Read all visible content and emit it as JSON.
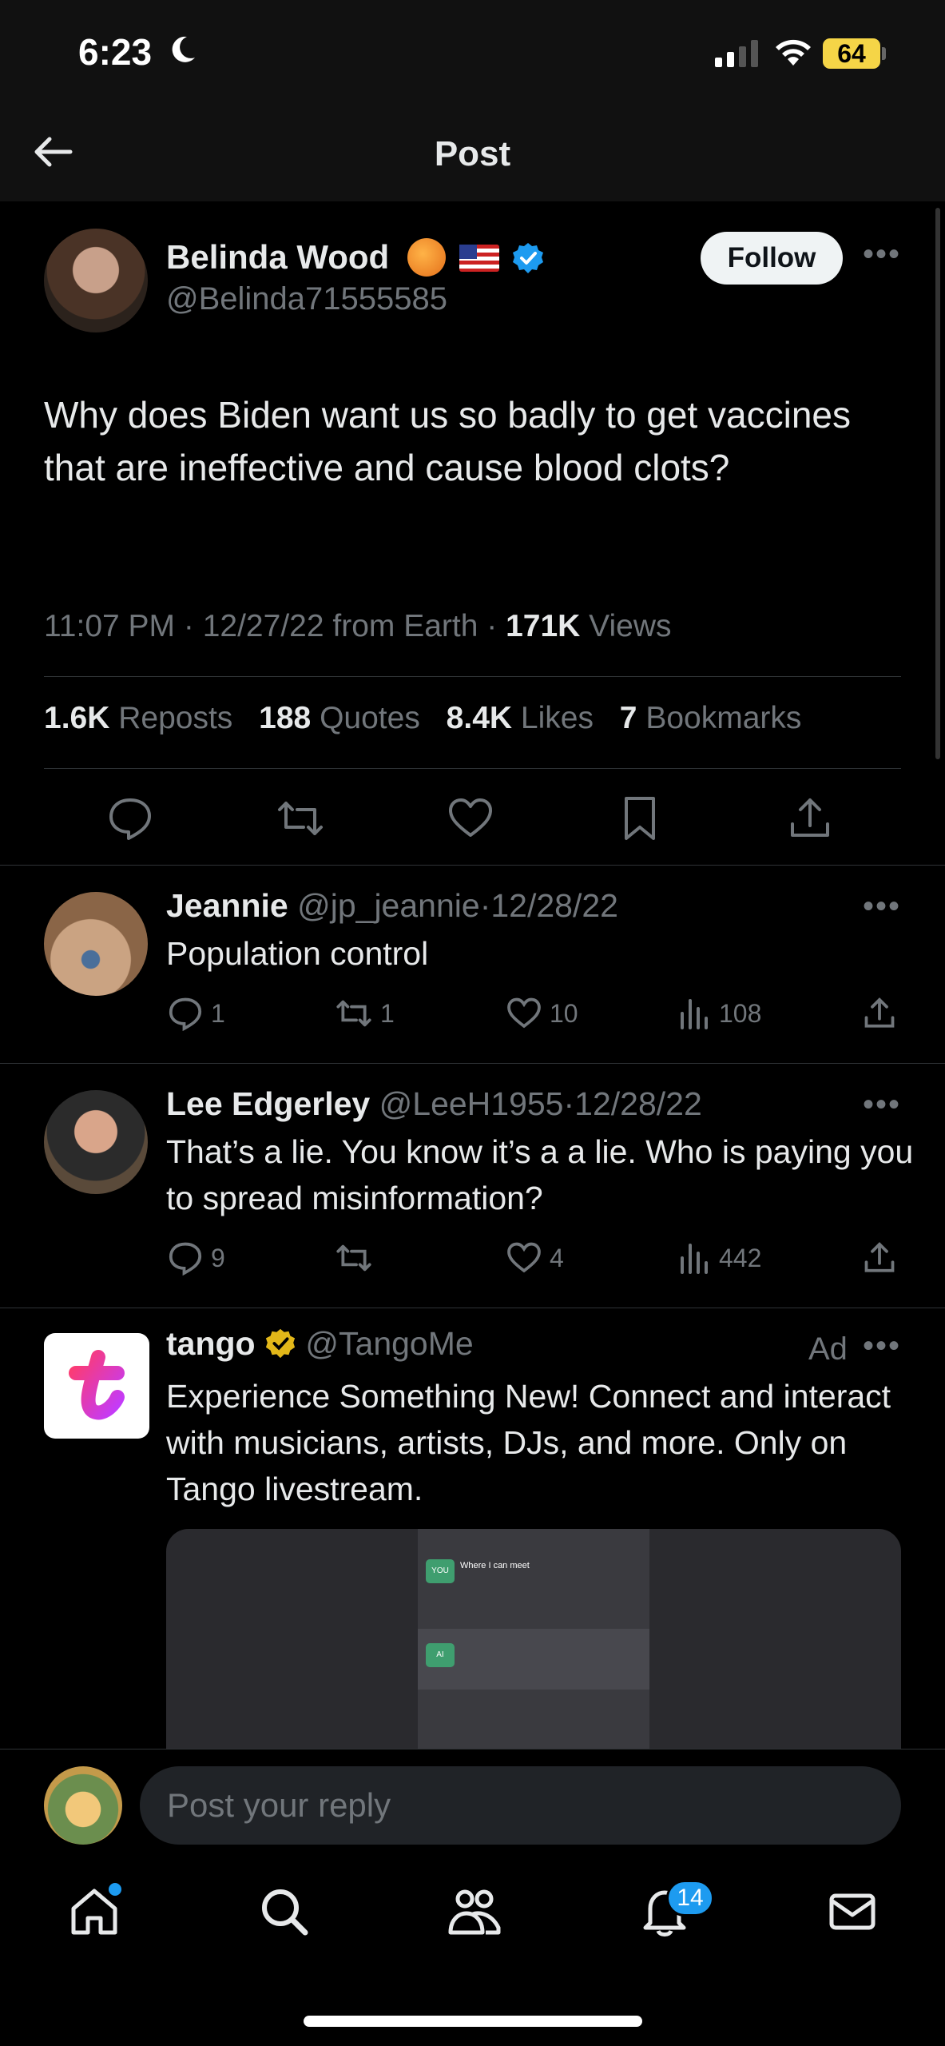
{
  "status": {
    "time": "6:23",
    "battery": "64"
  },
  "nav": {
    "title": "Post"
  },
  "post": {
    "author": "Belinda Wood",
    "handle": "@Belinda71555585",
    "follow_label": "Follow",
    "text": "Why does Biden want us so badly to get vaccines that are ineffective and cause blood clots?",
    "time": "11:07 PM",
    "date": "12/27/22 from Earth",
    "views_count": "171K",
    "views_label": "Views",
    "stats": {
      "reposts": "1.6K",
      "reposts_label": "Reposts",
      "quotes": "188",
      "quotes_label": "Quotes",
      "likes": "8.4K",
      "likes_label": "Likes",
      "bookmarks": "7",
      "bookmarks_label": "Bookmarks"
    }
  },
  "replies": [
    {
      "name": "Jeannie",
      "handle": "@jp_jeannie",
      "date": "12/28/22",
      "text": "Population control",
      "replies": "1",
      "reposts": "1",
      "likes": "10",
      "views": "108"
    },
    {
      "name": "Lee Edgerley",
      "handle": "@LeeH1955",
      "date": "12/28/22",
      "text": "That’s a lie. You know it’s a a lie. Who is paying you to spread misinformation?",
      "replies": "9",
      "reposts": "",
      "likes": "4",
      "views": "442"
    }
  ],
  "ad": {
    "name": "tango",
    "handle": "@TangoMe",
    "label": "Ad",
    "text": "Experience Something New! Connect and interact with musicians, artists, DJs, and more. Only on Tango livestream.",
    "chip_you": "YOU",
    "chip_you_text": "Where I can meet",
    "chip_ai": "AI"
  },
  "compose": {
    "placeholder": "Post your reply"
  },
  "tabs": {
    "notifications_badge": "14"
  },
  "colors": {
    "accent": "#1d9bf0",
    "background": "#000000",
    "muted": "#71767b"
  }
}
